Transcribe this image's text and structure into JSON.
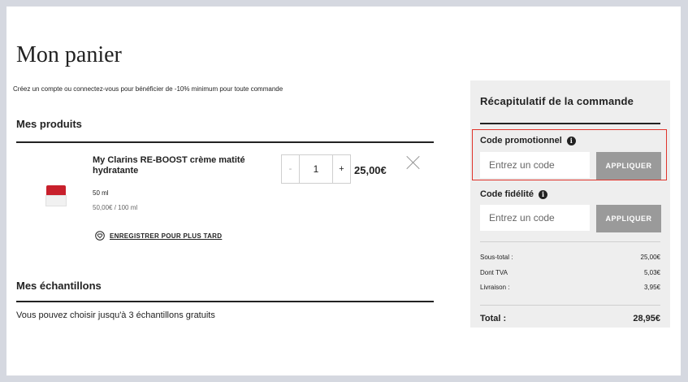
{
  "header": {
    "title": "Mon panier"
  },
  "promo_banner": "Créez un compte ou connectez-vous pour bénéficier de -10% minimum pour toute commande",
  "products_section": {
    "heading": "Mes produits"
  },
  "product": {
    "name": "My Clarins RE-BOOST crème matité hydratante",
    "size": "50 ml",
    "unit_price": "50,00€ / 100 ml",
    "quantity": "1",
    "qty_minus": "-",
    "qty_plus": "+",
    "price": "25,00€",
    "save_later": "ENREGISTRER POUR PLUS TARD"
  },
  "samples_section": {
    "heading": "Mes échantillons",
    "text": "Vous pouvez choisir jusqu'à 3 échantillons gratuits"
  },
  "summary": {
    "title": "Récapitulatif de la commande",
    "promo_label": "Code promotionnel",
    "promo_placeholder": "Entrez un code",
    "promo_apply": "APPLIQUER",
    "loyalty_label": "Code fidélité",
    "loyalty_placeholder": "Entrez un code",
    "loyalty_apply": "APPLIQUER",
    "info_glyph": "i",
    "rows": [
      {
        "label": "Sous-total :",
        "value": "25,00€"
      },
      {
        "label": "Dont TVA",
        "value": "5,03€"
      },
      {
        "label": "Livraison :",
        "value": "3,95€"
      }
    ],
    "total_label": "Total :",
    "total_value": "28,95€"
  },
  "colors": {
    "highlight": "#e0342b",
    "apply_button": "#9a9a9a",
    "summary_bg": "#eeeeee"
  }
}
